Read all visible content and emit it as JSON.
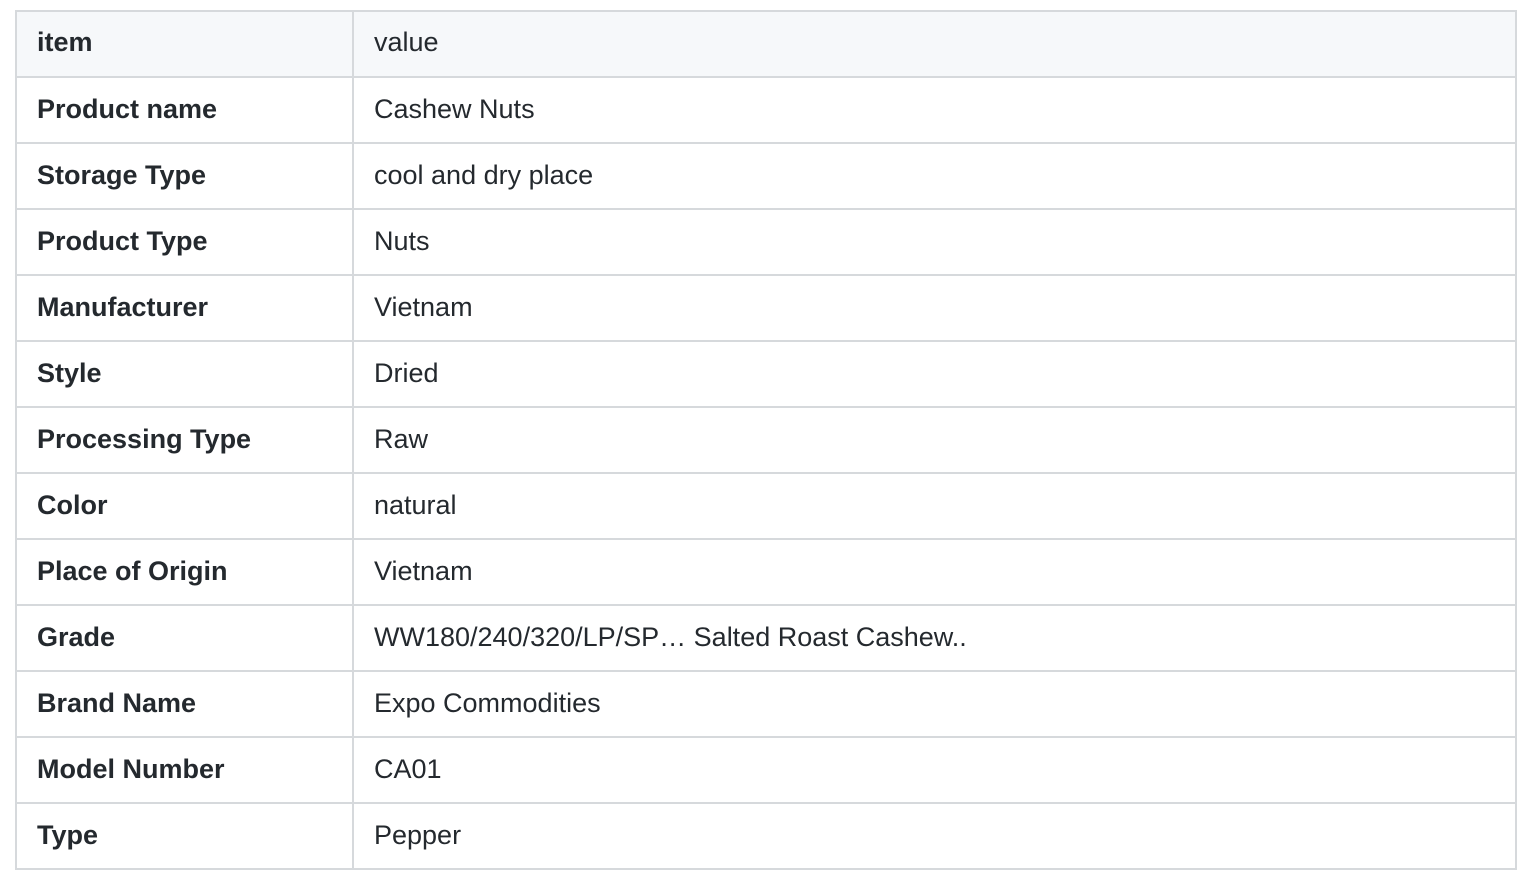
{
  "header": {
    "key": "item",
    "value": "value"
  },
  "rows": [
    {
      "key": "Product name",
      "value": "Cashew Nuts"
    },
    {
      "key": "Storage Type",
      "value": "cool and dry place"
    },
    {
      "key": "Product Type",
      "value": "Nuts"
    },
    {
      "key": "Manufacturer",
      "value": "Vietnam"
    },
    {
      "key": "Style",
      "value": "Dried"
    },
    {
      "key": "Processing Type",
      "value": "Raw"
    },
    {
      "key": "Color",
      "value": "natural"
    },
    {
      "key": "Place of Origin",
      "value": "Vietnam"
    },
    {
      "key": "Grade",
      "value": "WW180/240/320/LP/SP… Salted Roast Cashew.."
    },
    {
      "key": "Brand Name",
      "value": "Expo Commodities"
    },
    {
      "key": "Model Number",
      "value": "CA01"
    },
    {
      "key": "Type",
      "value": "Pepper"
    }
  ]
}
